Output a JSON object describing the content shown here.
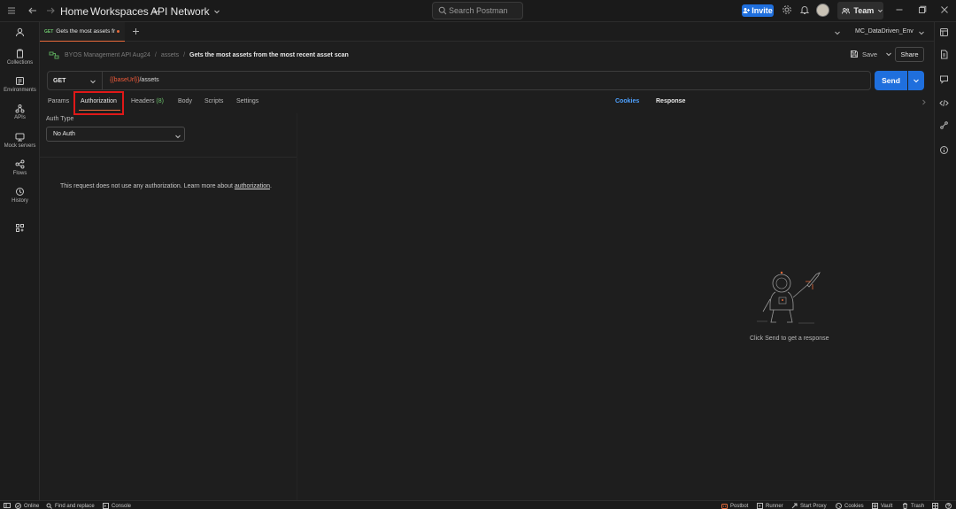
{
  "topbar": {
    "home": "Home",
    "workspaces": "Workspaces",
    "api_network": "API Network",
    "search_placeholder": "Search Postman",
    "invite": "Invite",
    "team": "Team"
  },
  "sidebar": {
    "items": [
      {
        "label": "",
        "icon": "user-icon"
      },
      {
        "label": "Collections",
        "icon": "collections-icon"
      },
      {
        "label": "Environments",
        "icon": "environments-icon"
      },
      {
        "label": "APIs",
        "icon": "apis-icon"
      },
      {
        "label": "Mock servers",
        "icon": "mock-servers-icon"
      },
      {
        "label": "Flows",
        "icon": "flows-icon"
      },
      {
        "label": "History",
        "icon": "history-icon"
      },
      {
        "label": "",
        "icon": "grid-icon"
      }
    ]
  },
  "tab": {
    "method": "GET",
    "title": "Gets the most assets fr"
  },
  "environment": {
    "name": "MC_DataDriven_Env"
  },
  "breadcrumb": {
    "collection": "BYOS Management API Aug24",
    "folder": "assets",
    "request": "Gets the most assets from the most recent asset scan"
  },
  "actions": {
    "save": "Save",
    "share": "Share",
    "send": "Send"
  },
  "request": {
    "method": "GET",
    "url_var": "{{baseUrl}}",
    "url_path": "/assets"
  },
  "request_tabs": {
    "params": "Params",
    "authorization": "Authorization",
    "headers": "Headers",
    "headers_count": "(8)",
    "body": "Body",
    "scripts": "Scripts",
    "settings": "Settings"
  },
  "response_header": {
    "cookies": "Cookies",
    "response": "Response"
  },
  "auth": {
    "type_label": "Auth Type",
    "selected": "No Auth",
    "note": "This request does not use any authorization. Learn more about ",
    "note_link": "authorization",
    "note_end": "."
  },
  "response": {
    "empty_message": "Click Send to get a response"
  },
  "statusbar": {
    "online": "Online",
    "find_replace": "Find and replace",
    "console": "Console",
    "postbot": "Postbot",
    "runner": "Runner",
    "start_proxy": "Start Proxy",
    "cookies": "Cookies",
    "vault": "Vault",
    "trash": "Trash"
  },
  "colors": {
    "accent_blue": "#1f6fdd",
    "accent_orange": "#e86a3a",
    "method_green": "#6bc26b",
    "variable_red": "#f05a3a",
    "highlight_red": "#e01818"
  }
}
